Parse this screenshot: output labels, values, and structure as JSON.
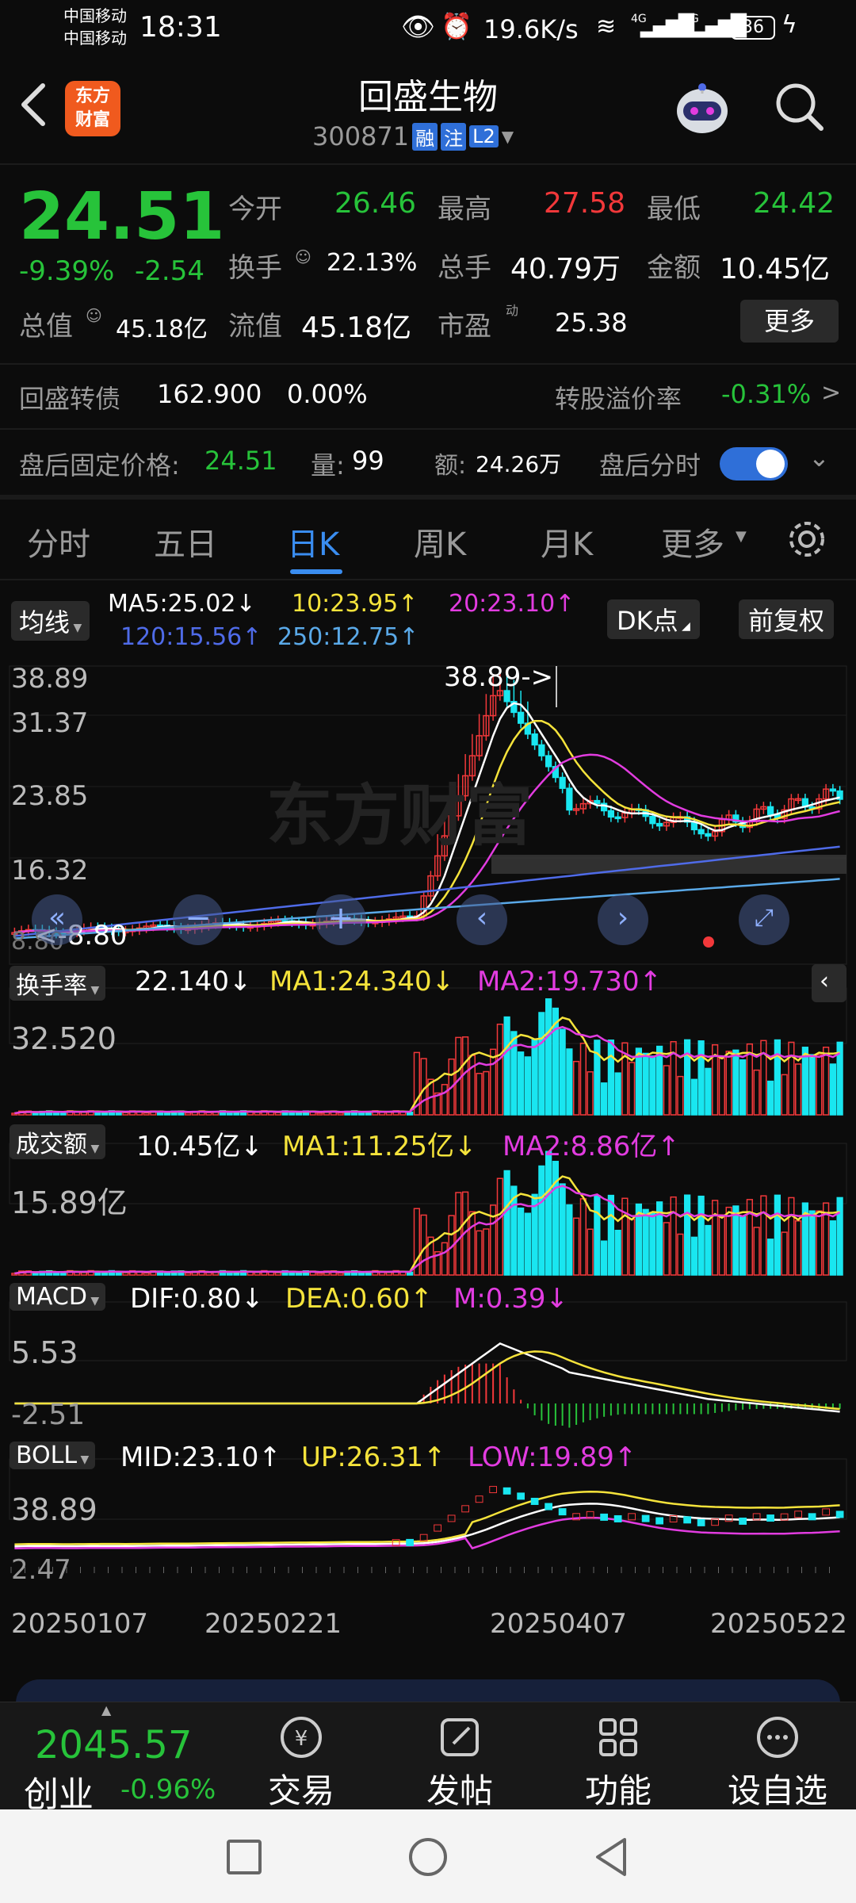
{
  "status_bar": {
    "carrier1": "中国移动",
    "carrier2": "中国移动",
    "time": "18:31",
    "speed": "19.6K/s",
    "signal1": "4G",
    "signal2": "5G",
    "battery": "36"
  },
  "header": {
    "logo_line1": "东方",
    "logo_line2": "财富",
    "title": "回盛生物",
    "code": "300871",
    "tag1": "融",
    "tag2": "注",
    "tag3": "L2"
  },
  "quote": {
    "price": "24.51",
    "change_pct": "-9.39%",
    "change": "-2.54",
    "open_label": "今开",
    "open": "26.46",
    "high_label": "最高",
    "high": "27.58",
    "low_label": "最低",
    "low": "24.42",
    "turnover_label": "换手",
    "turnover": "22.13%",
    "volume_label": "总手",
    "volume": "40.79万",
    "amount_label": "金额",
    "amount": "10.45亿",
    "total_cap_label": "总值",
    "total_cap": "45.18亿",
    "float_cap_label": "流值",
    "float_cap": "45.18亿",
    "pe_label": "市盈",
    "pe_sup": "动",
    "pe": "25.38",
    "more_button": "更多"
  },
  "bond": {
    "name": "回盛转债",
    "price": "162.900",
    "change": "0.00%",
    "premium_label": "转股溢价率",
    "premium": "-0.31%",
    "arrow": ">"
  },
  "after_hours": {
    "price_label": "盘后固定价格:",
    "price": "24.51",
    "vol_label": "量:",
    "vol": "99",
    "amt_label": "额:",
    "amt": "24.26万",
    "toggle_label": "盘后分时"
  },
  "tabs": [
    "分时",
    "五日",
    "日K",
    "周K",
    "月K",
    "更多"
  ],
  "active_tab": 2,
  "ma_bar": {
    "selector": "均线",
    "ma5": "MA5:25.02↓",
    "ma10": "10:23.95↑",
    "ma20": "20:23.10↑",
    "ma120": "120:15.56↑",
    "ma250": "250:12.75↑",
    "dk_button": "DK点",
    "adjust_button": "前复权"
  },
  "kline": {
    "y_labels": [
      "38.89",
      "31.37",
      "23.85",
      "16.32",
      "8.80"
    ],
    "max_label": "38.89->",
    "min_label": "<-8.80",
    "watermark": "东方财富"
  },
  "turnover_panel": {
    "selector": "换手率",
    "value": "22.140↓",
    "ma1": "MA1:24.340↓",
    "ma2": "MA2:19.730↑",
    "y_label": "32.520"
  },
  "volume_panel": {
    "selector": "成交额",
    "value": "10.45亿↓",
    "ma1": "MA1:11.25亿↓",
    "ma2": "MA2:8.86亿↑",
    "y_label": "15.89亿"
  },
  "macd_panel": {
    "selector": "MACD",
    "dif": "DIF:0.80↓",
    "dea": "DEA:0.60↑",
    "m": "M:0.39↓",
    "y_top": "5.53",
    "y_bottom": "-2.51"
  },
  "boll_panel": {
    "selector": "BOLL",
    "mid": "MID:23.10↑",
    "up": "UP:26.31↑",
    "low": "LOW:19.89↑",
    "y_top": "38.89",
    "y_bottom": "2.47"
  },
  "dates": [
    "20250107",
    "20250221",
    "20250407",
    "20250522"
  ],
  "bottom_nav": {
    "index_value": "2045.57",
    "index_name": "创业",
    "index_change": "-0.96%",
    "items": [
      "交易",
      "发帖",
      "功能",
      "设自选"
    ]
  },
  "colors": {
    "up": "#f2383a",
    "down": "#27c33a",
    "cyan_bar": "#19e6f0",
    "ma5": "#ffffff",
    "ma10": "#f5e33b",
    "ma20": "#e23ce0",
    "ma120": "#4f6be8",
    "ma250": "#5aa9e8"
  }
}
